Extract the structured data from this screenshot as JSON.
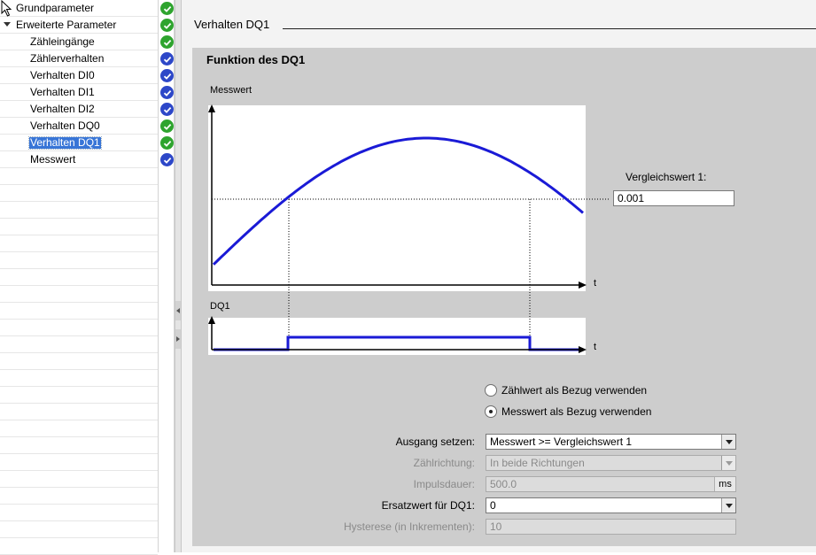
{
  "nav": {
    "items": [
      {
        "label": "Grundparameter",
        "status": "green",
        "expandable": false,
        "indent": 0,
        "selected": false
      },
      {
        "label": "Erweiterte Parameter",
        "status": "green",
        "expandable": true,
        "indent": 0,
        "selected": false
      },
      {
        "label": "Zähleingänge",
        "status": "green",
        "expandable": false,
        "indent": 1,
        "selected": false
      },
      {
        "label": "Zählerverhalten",
        "status": "blue",
        "expandable": false,
        "indent": 1,
        "selected": false
      },
      {
        "label": "Verhalten DI0",
        "status": "blue",
        "expandable": false,
        "indent": 1,
        "selected": false
      },
      {
        "label": "Verhalten DI1",
        "status": "blue",
        "expandable": false,
        "indent": 1,
        "selected": false
      },
      {
        "label": "Verhalten DI2",
        "status": "blue",
        "expandable": false,
        "indent": 1,
        "selected": false
      },
      {
        "label": "Verhalten DQ0",
        "status": "green",
        "expandable": false,
        "indent": 1,
        "selected": false
      },
      {
        "label": "Verhalten DQ1",
        "status": "green",
        "expandable": false,
        "indent": 1,
        "selected": true
      },
      {
        "label": "Messwert",
        "status": "blue",
        "expandable": false,
        "indent": 1,
        "selected": false
      }
    ]
  },
  "section": {
    "title": "Verhalten DQ1"
  },
  "panel": {
    "title": "Funktion des DQ1",
    "upper_axis_label": "Messwert",
    "lower_axis_label": "DQ1",
    "time_label": "t",
    "compare_label": "Vergleichswert 1:",
    "compare_value": "0.001"
  },
  "radios": [
    {
      "label": "Zählwert als Bezug verwenden",
      "checked": false
    },
    {
      "label": "Messwert als Bezug verwenden",
      "checked": true
    }
  ],
  "params": {
    "ausgang": {
      "label": "Ausgang setzen:",
      "value": "Messwert >= Vergleichswert 1"
    },
    "zaehlrichtung": {
      "label": "Zählrichtung:",
      "value": "In beide Richtungen"
    },
    "impulsdauer": {
      "label": "Impulsdauer:",
      "value": "500.0",
      "unit": "ms"
    },
    "ersatzwert": {
      "label": "Ersatzwert für DQ1:",
      "value": "0"
    },
    "hysterese": {
      "label": "Hysterese (in Inkrementen):",
      "value": "10"
    }
  },
  "colors": {
    "curve": "#1a1ad6",
    "status_green": "#2ea42e",
    "status_blue": "#2d47c8",
    "selection": "#3875d7"
  }
}
